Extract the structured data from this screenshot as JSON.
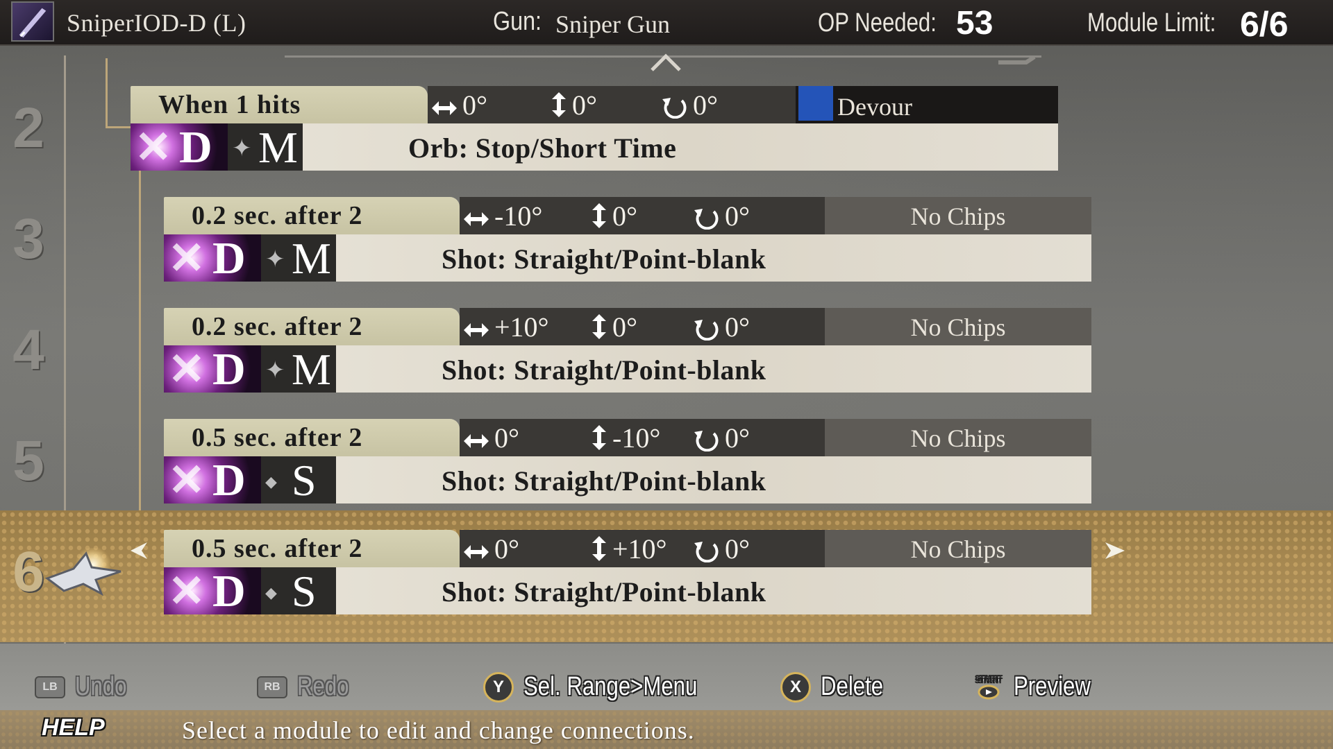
{
  "header": {
    "module_name": "SniperIOD-D (L)",
    "gun_label": "Gun:",
    "gun_value": "Sniper Gun",
    "op_label": "OP Needed:",
    "op_value": "53",
    "limit_label": "Module  Limit:",
    "limit_value": "6/6",
    "weapon_icon": "sword-icon"
  },
  "rows": [
    {
      "number": "2"
    },
    {
      "number": "3"
    },
    {
      "number": "4"
    },
    {
      "number": "5"
    },
    {
      "number": "6",
      "selected": true
    }
  ],
  "modules": [
    {
      "trigger": "When  1  hits",
      "h": "0°",
      "v": "0°",
      "r": "0°",
      "chip": "Devour",
      "chip_icon": "devour-icon",
      "type": "D",
      "size": "M",
      "body": "Orb: Stop/Short Time"
    },
    {
      "trigger": "0.2  sec.  after  2",
      "h": "-10°",
      "v": "0°",
      "r": "0°",
      "chip": "No Chips",
      "type": "D",
      "size": "M",
      "body": "Shot: Straight/Point-blank"
    },
    {
      "trigger": "0.2  sec.  after  2",
      "h": "+10°",
      "v": "0°",
      "r": "0°",
      "chip": "No Chips",
      "type": "D",
      "size": "M",
      "body": "Shot: Straight/Point-blank"
    },
    {
      "trigger": "0.5  sec.  after  2",
      "h": "0°",
      "v": "-10°",
      "r": "0°",
      "chip": "No Chips",
      "type": "D",
      "size": "S",
      "body": "Shot: Straight/Point-blank"
    },
    {
      "trigger": "0.5  sec.  after  2",
      "h": "0°",
      "v": "+10°",
      "r": "0°",
      "chip": "No Chips",
      "type": "D",
      "size": "S",
      "body": "Shot: Straight/Point-blank"
    }
  ],
  "controls": {
    "undo": {
      "button": "LB",
      "label": "Undo",
      "enabled": false
    },
    "redo": {
      "button": "RB",
      "label": "Redo",
      "enabled": false
    },
    "menu": {
      "button": "Y",
      "label": "Sel. Range>Menu"
    },
    "delete": {
      "button": "X",
      "label": "Delete"
    },
    "preview": {
      "button": "START",
      "label": "Preview"
    }
  },
  "help": {
    "label": "HELP",
    "text": "Select  a  module  to  edit  and  change  connections."
  },
  "colors": {
    "selected_band": "#a98a50",
    "angle_bar": "#3a3835",
    "chip_box": "#5e5b56",
    "chip_devour": "#1a1817",
    "accent_gold": "#d6b45b"
  }
}
